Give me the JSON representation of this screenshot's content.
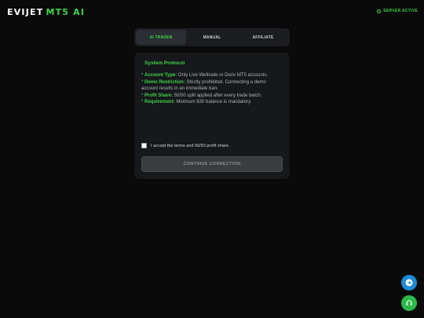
{
  "brand": {
    "name_part1": "EVIJET",
    "name_part2": "MT5 AI"
  },
  "server_status": {
    "label": "SERVER ACTIVE"
  },
  "tabs": [
    {
      "label": "AI TRADER",
      "active": true
    },
    {
      "label": "MANUAL",
      "active": false
    },
    {
      "label": "AFFILIATE",
      "active": false
    }
  ],
  "protocol": {
    "title": "System Protocol",
    "rules": [
      {
        "bullet": "*",
        "key": "Account Type:",
        "text": "Only Live Weltrade or Deriv MT5 accounts."
      },
      {
        "bullet": "*",
        "key": "Demo Restriction:",
        "text": "Strictly prohibited. Connecting a demo account results in an immediate ban."
      },
      {
        "bullet": "*",
        "key": "Profit Share:",
        "text": "50/50 split applied after every trade batch."
      },
      {
        "bullet": "*",
        "key": "Requirement:",
        "text": "Minimum $30 balance is mandatory."
      }
    ],
    "accept_label": "I accept the terms and 50/50 profit share.",
    "accept_checked": false,
    "continue_label": "CONTINUE CONNECTION"
  },
  "floating_buttons": {
    "telegram_icon": "telegram-icon",
    "support_icon": "headset-icon"
  },
  "colors": {
    "accent": "#3fd34a",
    "background": "#0a0a0b",
    "panel": "#16181b",
    "telegram": "#1e8bd6",
    "support": "#2db84a"
  }
}
